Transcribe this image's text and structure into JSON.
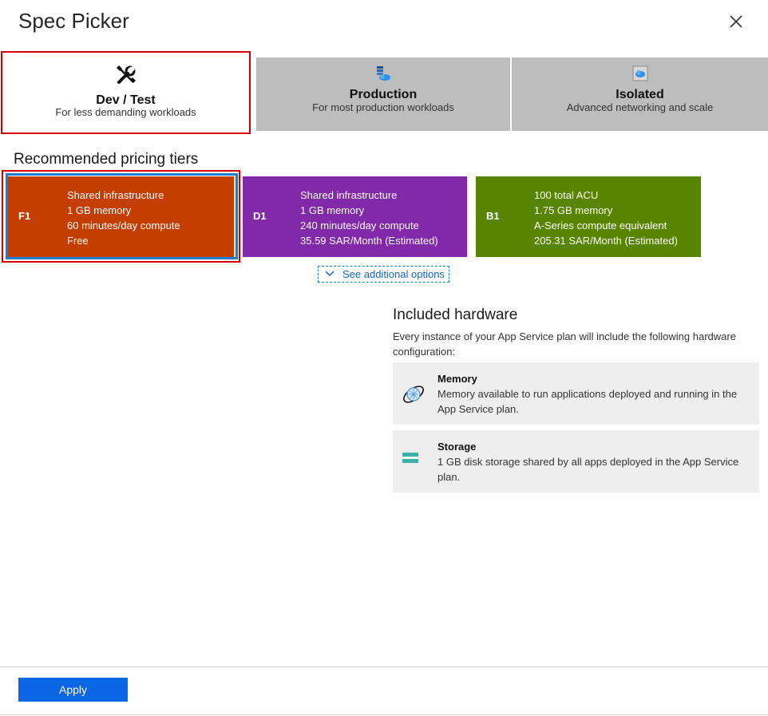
{
  "dialog": {
    "title": "Spec Picker"
  },
  "tabs": [
    {
      "name": "Dev / Test",
      "description": "For less demanding workloads",
      "icon": "tools-icon",
      "active": true
    },
    {
      "name": "Production",
      "description": "For most production workloads",
      "icon": "server-cloud-icon",
      "active": false
    },
    {
      "name": "Isolated",
      "description": "Advanced networking and scale",
      "icon": "isolated-cloud-icon",
      "active": false
    }
  ],
  "recommended": {
    "title": "Recommended pricing tiers",
    "tiers": [
      {
        "code": "F1",
        "color": "#c33e00",
        "lines": [
          "Shared infrastructure",
          "1 GB memory",
          "60 minutes/day compute",
          "Free"
        ],
        "selected": true
      },
      {
        "code": "D1",
        "color": "#8129a9",
        "lines": [
          "Shared infrastructure",
          "1 GB memory",
          "240 minutes/day compute",
          "35.59 SAR/Month (Estimated)"
        ],
        "selected": false
      },
      {
        "code": "B1",
        "color": "#588500",
        "lines": [
          "100 total ACU",
          "1.75 GB memory",
          "A-Series compute equivalent",
          "205.31 SAR/Month (Estimated)"
        ],
        "selected": false
      }
    ],
    "see_more": "See additional options"
  },
  "hardware": {
    "title": "Included hardware",
    "description": "Every instance of your App Service plan will include the following hardware configuration:",
    "items": [
      {
        "name": "Memory",
        "description": "Memory available to run applications deployed and running in the App Service plan.",
        "icon": "memory-icon"
      },
      {
        "name": "Storage",
        "description": "1 GB disk storage shared by all apps deployed in the App Service plan.",
        "icon": "storage-icon"
      }
    ]
  },
  "footer": {
    "apply_label": "Apply"
  },
  "colors": {
    "accent": "#0a66e4",
    "selection_red": "#d40000",
    "selection_blue": "#1f7ed0",
    "tab_inactive": "#bdbdbd"
  }
}
